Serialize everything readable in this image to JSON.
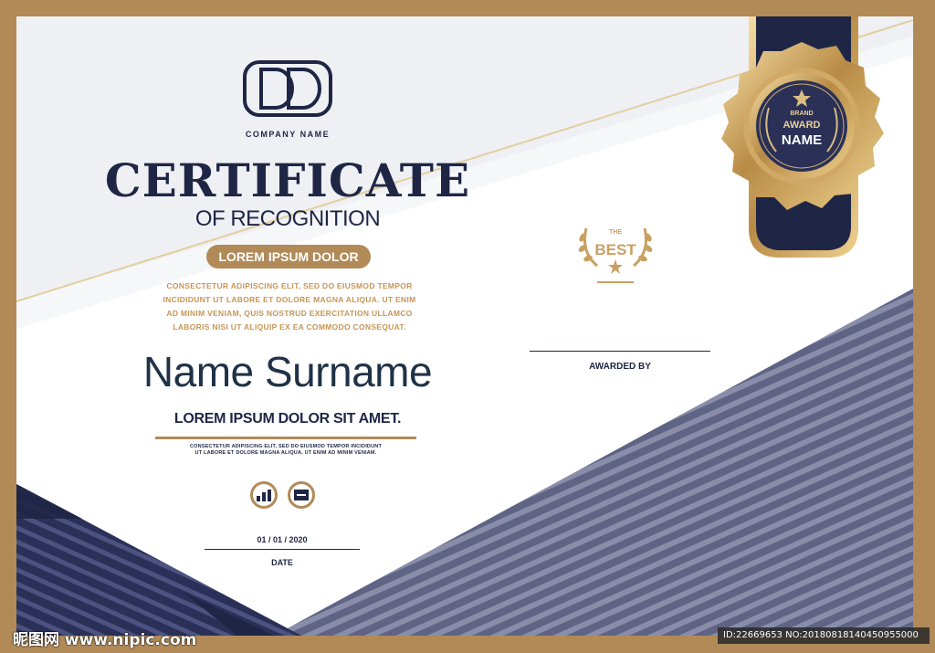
{
  "logo": {
    "monogram": "DD",
    "company_name": "COMPANY NAME"
  },
  "certificate": {
    "title": "CERTIFICATE",
    "subtitle": "OF RECOGNITION",
    "pill_label": "LOREM IPSUM DOLOR",
    "paragraph": "CONSECTETUR ADIPISCING ELIT, SED DO EIUSMOD TEMPOR INCIDIDUNT UT LABORE ET DOLORE MAGNA ALIQUA. UT ENIM AD MINIM VENIAM, QUIS NOSTRUD EXERCITATION ULLAMCO LABORIS NISI UT ALIQUIP EX EA COMMODO CONSEQUAT.",
    "recipient_name": "Name Surname",
    "headline": "LOREM IPSUM DOLOR SIT AMET.",
    "small_text": "CONSECTETUR ADIPISCING ELIT, SED DO EIUSMOD TEMPOR INCIDIDUNT UT LABORE ET DOLORE MAGNA ALIQUA. UT ENIM AD MINIM VENIAM.",
    "date_value": "01 / 01 / 2020",
    "date_label": "DATE",
    "awarded_by_label": "AWARDED BY"
  },
  "best_badge": {
    "top": "THE",
    "main": "BEST"
  },
  "seal": {
    "line1": "BRAND",
    "line2": "AWARD",
    "line3": "NAME"
  },
  "icons": [
    "chart-icon",
    "card-icon"
  ],
  "colors": {
    "navy": "#1f2645",
    "gold": "#b18a58",
    "stripe": "#6d7191",
    "bg": "#ffffff"
  },
  "watermark": {
    "left": "昵图网 www.nipic.com",
    "right": "ID:22669653 NO:20180818140450955000"
  }
}
